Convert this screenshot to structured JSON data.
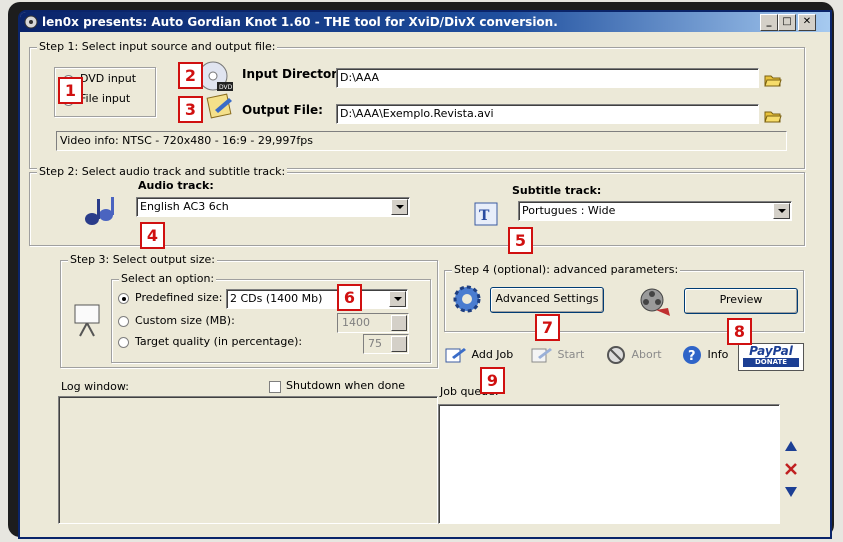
{
  "window": {
    "title": "len0x presents: Auto Gordian Knot 1.60 - THE tool for XviD/DivX conversion.",
    "min_symbol": "_",
    "max_symbol": "□",
    "close_symbol": "✕"
  },
  "step1": {
    "legend": "Step 1: Select input source and output file:",
    "source_options": [
      {
        "label": "DVD input",
        "selected": true
      },
      {
        "label": "File input",
        "selected": false
      }
    ],
    "input_directory_label": "Input Directory",
    "input_directory_value": "D:\\AAA",
    "output_file_label": "Output File:",
    "output_file_value": "D:\\AAA\\Exemplo.Revista.avi",
    "video_info": "Video info:  NTSC - 720x480 - 16:9 - 29,997fps"
  },
  "step2": {
    "legend": "Step 2: Select audio track and subtitle track:",
    "audio_label": "Audio track:",
    "audio_value": "English AC3 6ch",
    "subtitle_label": "Subtitle track:",
    "subtitle_value": "Portugues : Wide"
  },
  "step3": {
    "legend": "Step 3: Select output size:",
    "inner_legend": "Select an option:",
    "options": [
      {
        "label": "Predefined size:",
        "selected": true
      },
      {
        "label": "Custom size (MB):",
        "selected": false
      },
      {
        "label": "Target quality (in percentage):",
        "selected": false
      }
    ],
    "predefined_value": "2 CDs (1400 Mb)",
    "custom_value": "1400",
    "quality_value": "75"
  },
  "step4": {
    "legend": "Step 4 (optional): advanced parameters:",
    "advanced_button": "Advanced Settings",
    "preview_button": "Preview"
  },
  "actions": {
    "add_job": "Add Job",
    "start": "Start",
    "abort": "Abort",
    "info": "Info",
    "paypal_title": "PayPal",
    "paypal_sub": "DONATE"
  },
  "log": {
    "label": "Log window:",
    "shutdown_label": "Shutdown when done"
  },
  "queue": {
    "label": "Job queue:"
  },
  "callouts": [
    "1",
    "2",
    "3",
    "4",
    "5",
    "6",
    "7",
    "8",
    "9"
  ],
  "colors": {
    "title_start": "#0a246a",
    "title_end": "#a6caf0",
    "callout": "#d01010",
    "window_bg": "#ece9d8"
  }
}
